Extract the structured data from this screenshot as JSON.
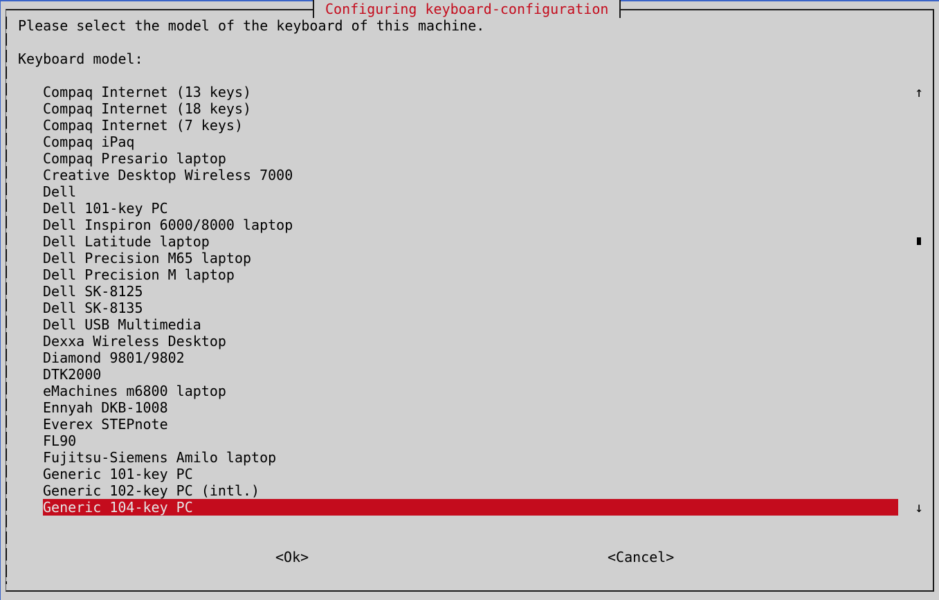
{
  "dialog": {
    "title": "Configuring keyboard-configuration",
    "prompt": "Please select the model of the keyboard of this machine.",
    "field_label": "Keyboard model:"
  },
  "list": {
    "items": [
      "Compaq Internet (13 keys)",
      "Compaq Internet (18 keys)",
      "Compaq Internet (7 keys)",
      "Compaq iPaq",
      "Compaq Presario laptop",
      "Creative Desktop Wireless 7000",
      "Dell",
      "Dell 101-key PC",
      "Dell Inspiron 6000/8000 laptop",
      "Dell Latitude laptop",
      "Dell Precision M65 laptop",
      "Dell Precision M laptop",
      "Dell SK-8125",
      "Dell SK-8135",
      "Dell USB Multimedia",
      "Dexxa Wireless Desktop",
      "Diamond 9801/9802",
      "DTK2000",
      "eMachines m6800 laptop",
      "Ennyah DKB-1008",
      "Everex STEPnote",
      "FL90",
      "Fujitsu-Siemens Amilo laptop",
      "Generic 101-key PC",
      "Generic 102-key PC (intl.)",
      "Generic 104-key PC"
    ],
    "selected": "Generic 104-key PC"
  },
  "scrollbar": {
    "up_arrow": "↑",
    "down_arrow": "↓"
  },
  "buttons": {
    "ok": "<Ok>",
    "cancel": "<Cancel>"
  },
  "colors": {
    "background": "#d0d0d0",
    "accent": "#c40c1d",
    "selected_text": "#e6e6e6"
  }
}
